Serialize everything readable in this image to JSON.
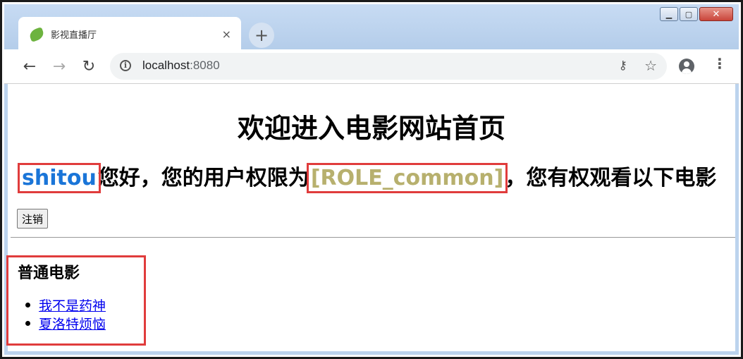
{
  "window": {
    "controls": [
      "minimize-icon",
      "maximize-icon",
      "close-icon"
    ]
  },
  "tab": {
    "title": "影视直播厅",
    "favicon": "spring-leaf-icon",
    "close_icon": "×"
  },
  "new_tab_icon": "+",
  "toolbar": {
    "back_icon": "←",
    "forward_icon": "→",
    "reload_icon": "↻",
    "url_host": "localhost",
    "url_port": ":8080",
    "key_icon": "⚷",
    "star_icon": "☆",
    "menu_icon": "⋮"
  },
  "page": {
    "heading": "欢迎进入电影网站首页",
    "username": "shitou",
    "greeting_mid": "您好，您的用户权限为",
    "role": "[ROLE_common]",
    "greeting_end": "，您有权观看以下电影",
    "logout_label": "注销",
    "category_title": "普通电影",
    "movies": [
      "我不是药神",
      "夏洛特烦恼"
    ]
  },
  "colors": {
    "username": "#1a75d8",
    "role": "#b7b06e",
    "highlight_border": "#e03c3c",
    "link": "#0000ee"
  }
}
